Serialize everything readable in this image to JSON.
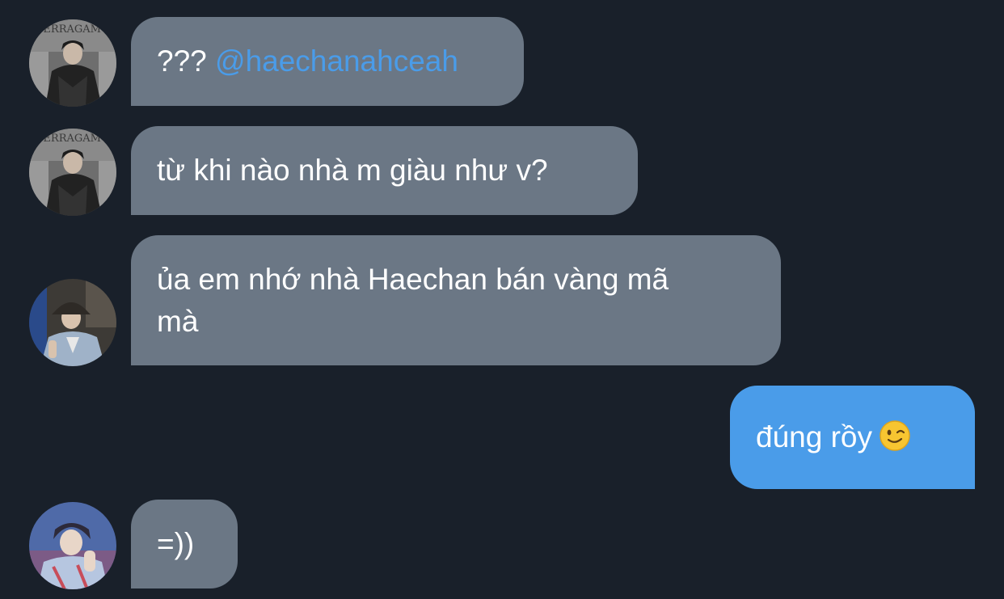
{
  "messages": [
    {
      "id": "m1",
      "sender": "incoming",
      "text": "???",
      "mention": "@haechanahceah"
    },
    {
      "id": "m2",
      "sender": "incoming",
      "text": "từ khi nào nhà m giàu như v?"
    },
    {
      "id": "m3",
      "sender": "incoming",
      "lines": [
        "ủa em nhớ nhà Haechan bán vàng mã",
        "mà"
      ]
    },
    {
      "id": "m4",
      "sender": "outgoing",
      "text": "đúng rồy",
      "emoji": "winking-face"
    },
    {
      "id": "m5",
      "sender": "incoming",
      "text": "=))"
    }
  ],
  "avatar_signage": "FERRAGAMO",
  "colors": {
    "background": "#19202a",
    "incoming_bubble": "#6b7785",
    "outgoing_bubble": "#4a9ce9",
    "mention": "#4a9ce9",
    "text": "#ffffff"
  }
}
